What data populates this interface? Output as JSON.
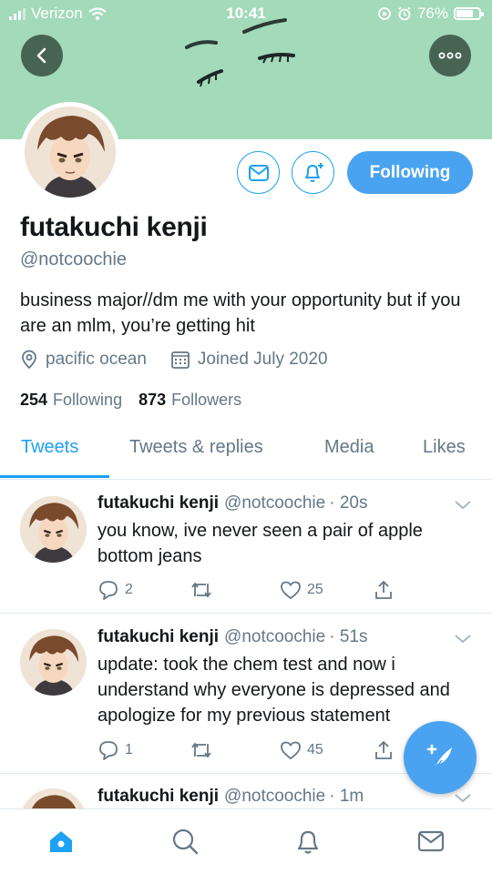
{
  "status_bar": {
    "carrier": "Verizon",
    "time": "10:41",
    "battery": "76%",
    "battery_level": 0.76
  },
  "colors": {
    "accent": "#1da1f2",
    "banner": "#a3dab9",
    "secondary_text": "#657786"
  },
  "header": {
    "back_icon": "chevron-left-icon",
    "more_icon": "more-horizontal-icon"
  },
  "profile": {
    "name": "futakuchi kenji",
    "handle": "@notcoochie",
    "bio": "business major//dm me with your opportunity but if you are an mlm, you’re getting hit",
    "location": "pacific ocean",
    "joined": "Joined July 2020",
    "following_count": "254",
    "following_label": "Following",
    "followers_count": "873",
    "followers_label": "Followers",
    "following_button": "Following"
  },
  "tabs": [
    {
      "label": "Tweets",
      "active": true
    },
    {
      "label": "Tweets & replies",
      "active": false
    },
    {
      "label": "Media",
      "active": false
    },
    {
      "label": "Likes",
      "active": false
    }
  ],
  "tweets": [
    {
      "name": "futakuchi kenji",
      "handle": "@notcoochie",
      "time": "· 20s",
      "text": "you know, ive never seen a pair of apple bottom jeans",
      "replies": "2",
      "retweets": "",
      "likes": "25"
    },
    {
      "name": "futakuchi kenji",
      "handle": "@notcoochie",
      "time": "· 51s",
      "text": "update: took the chem test and now i understand why everyone is depressed and apologize for my previous statement",
      "replies": "1",
      "retweets": "",
      "likes": "45"
    },
    {
      "name": "futakuchi kenji",
      "handle": "@notcoochie",
      "time": "· 1m",
      "text": "",
      "replies": "",
      "retweets": "",
      "likes": ""
    }
  ],
  "bottom_nav": [
    "home-icon",
    "search-icon",
    "notifications-icon",
    "messages-icon"
  ]
}
